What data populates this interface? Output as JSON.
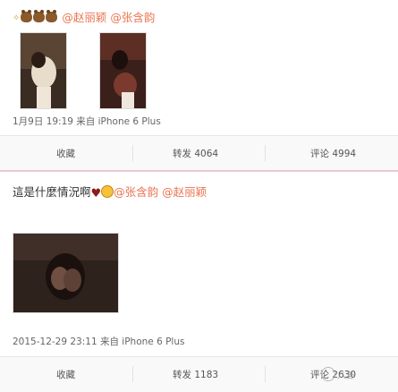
{
  "post1": {
    "text": "@赵丽颖 @张含韵",
    "emoji": [
      "sparkle",
      "bear",
      "bear",
      "bear"
    ],
    "meta": "1月9日 19:19 来自 iPhone 6 Plus",
    "actions": {
      "fav": "收藏",
      "repost": "转发 4064",
      "comment": "评论 4994"
    }
  },
  "post2": {
    "text_prefix": "這是什麼情況啊",
    "text_mentions": "@张含韵 @赵丽颖",
    "emoji": [
      "heart",
      "smile"
    ],
    "meta": "2015-12-29 23:11 来自 iPhone 6 Plus",
    "actions": {
      "fav": "收藏",
      "repost": "转发 1183",
      "comment": "评论 2630"
    }
  },
  "watermark": "八卦"
}
